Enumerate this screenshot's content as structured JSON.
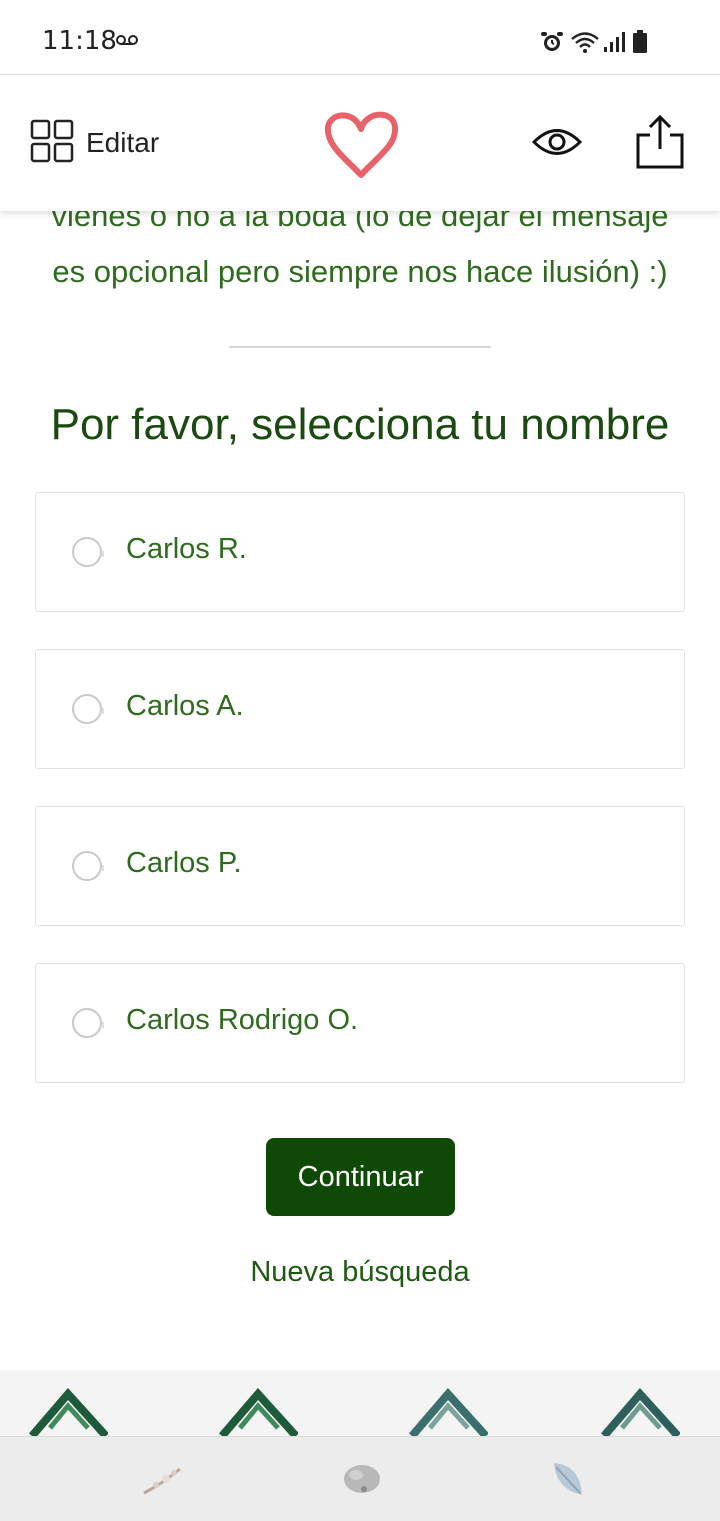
{
  "status_bar": {
    "time": "11:18",
    "voicemail_icon": "voicemail-icon",
    "icons": [
      "alarm-icon",
      "wifi-icon",
      "signal-icon",
      "battery-icon"
    ]
  },
  "header": {
    "edit_label": "Editar",
    "icons": [
      "grid-icon",
      "heart-logo-icon",
      "eye-icon",
      "share-icon"
    ],
    "heart_color": "#e8626a"
  },
  "main": {
    "intro_line1": "vienes o no a la boda (lo de dejar el mensaje",
    "intro_line2": "es opcional pero siempre nos hace ilusión) :)",
    "title": "Por favor, selecciona tu nombre",
    "options": [
      {
        "label": "Carlos R.",
        "selected": false
      },
      {
        "label": "Carlos A.",
        "selected": false
      },
      {
        "label": "Carlos P.",
        "selected": false
      },
      {
        "label": "Carlos Rodrigo O.",
        "selected": false
      }
    ],
    "continue_label": "Continuar",
    "new_search_label": "Nueva búsqueda"
  },
  "colors": {
    "primary_green": "#0e4a06",
    "text_green": "#2f6b1e",
    "heart_pink": "#e8626a"
  },
  "bottom_nav": {
    "icons": [
      "branch-icon",
      "stone-icon",
      "feather-icon"
    ]
  }
}
